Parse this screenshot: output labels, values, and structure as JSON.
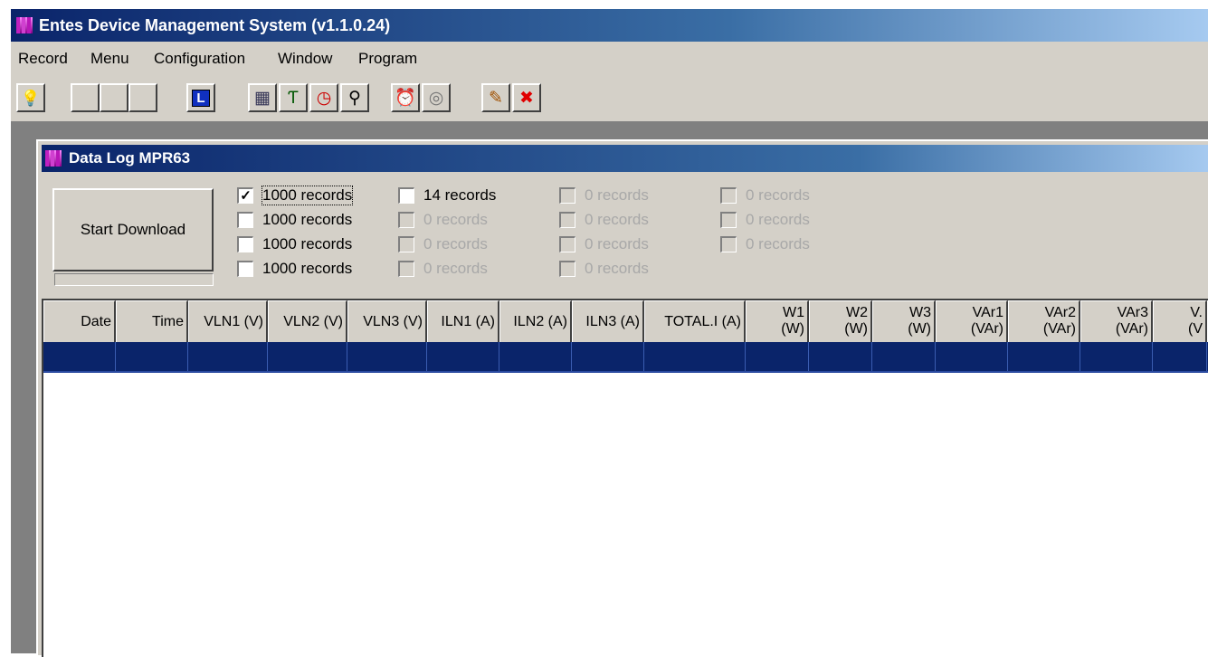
{
  "window": {
    "title": "Entes Device Management System  (v1.1.0.24)"
  },
  "menu": [
    "Record",
    "Menu",
    "Configuration",
    "Window",
    "Program"
  ],
  "toolbar": {
    "buttons": [
      {
        "icon": "lightbulb-icon",
        "glyph": "💡"
      },
      {
        "icon": "blank",
        "glyph": ""
      },
      {
        "icon": "blank",
        "glyph": ""
      },
      {
        "icon": "blank",
        "glyph": ""
      },
      {
        "icon": "l-icon",
        "glyph": "L"
      },
      {
        "icon": "calendar-icon",
        "glyph": "▦"
      },
      {
        "icon": "device-icon",
        "glyph": "Ƭ"
      },
      {
        "icon": "clock-icon",
        "glyph": "◷"
      },
      {
        "icon": "person-icon",
        "glyph": "⚲"
      },
      {
        "icon": "alarm-clock-icon",
        "glyph": "⏰"
      },
      {
        "icon": "disc-icon",
        "glyph": "◎"
      },
      {
        "icon": "edit-icon",
        "glyph": "✎"
      },
      {
        "icon": "close-icon",
        "glyph": "✖"
      }
    ]
  },
  "child": {
    "title": "Data Log MPR63",
    "start_label": "Start Download",
    "checkbox_columns": [
      [
        {
          "label": "1000 records",
          "checked": true,
          "disabled": false
        },
        {
          "label": "1000 records",
          "checked": false,
          "disabled": false
        },
        {
          "label": "1000 records",
          "checked": false,
          "disabled": false
        },
        {
          "label": "1000 records",
          "checked": false,
          "disabled": false
        }
      ],
      [
        {
          "label": "14 records",
          "checked": false,
          "disabled": false
        },
        {
          "label": "0 records",
          "checked": false,
          "disabled": true
        },
        {
          "label": "0 records",
          "checked": false,
          "disabled": true
        },
        {
          "label": "0 records",
          "checked": false,
          "disabled": true
        }
      ],
      [
        {
          "label": "0 records",
          "checked": false,
          "disabled": true
        },
        {
          "label": "0 records",
          "checked": false,
          "disabled": true
        },
        {
          "label": "0 records",
          "checked": false,
          "disabled": true
        },
        {
          "label": "0 records",
          "checked": false,
          "disabled": true
        }
      ],
      [
        {
          "label": "0 records",
          "checked": false,
          "disabled": true
        },
        {
          "label": "0 records",
          "checked": false,
          "disabled": true
        },
        {
          "label": "0 records",
          "checked": false,
          "disabled": true
        }
      ]
    ]
  },
  "grid": {
    "columns": [
      {
        "l1": "Date",
        "l2": ""
      },
      {
        "l1": "Time",
        "l2": ""
      },
      {
        "l1": "VLN1 (V)",
        "l2": ""
      },
      {
        "l1": "VLN2 (V)",
        "l2": ""
      },
      {
        "l1": "VLN3 (V)",
        "l2": ""
      },
      {
        "l1": "ILN1 (A)",
        "l2": ""
      },
      {
        "l1": "ILN2 (A)",
        "l2": ""
      },
      {
        "l1": "ILN3 (A)",
        "l2": ""
      },
      {
        "l1": "TOTAL.I (A)",
        "l2": ""
      },
      {
        "l1": "W1",
        "l2": "(W)"
      },
      {
        "l1": "W2",
        "l2": "(W)"
      },
      {
        "l1": "W3",
        "l2": "(W)"
      },
      {
        "l1": "VAr1",
        "l2": "(VAr)"
      },
      {
        "l1": "VAr2",
        "l2": "(VAr)"
      },
      {
        "l1": "VAr3",
        "l2": "(VAr)"
      },
      {
        "l1": "V.",
        "l2": "(V"
      }
    ]
  },
  "colors": {
    "title_active": "#0a246a",
    "face": "#d4d0c8",
    "selection": "#0a246a"
  }
}
